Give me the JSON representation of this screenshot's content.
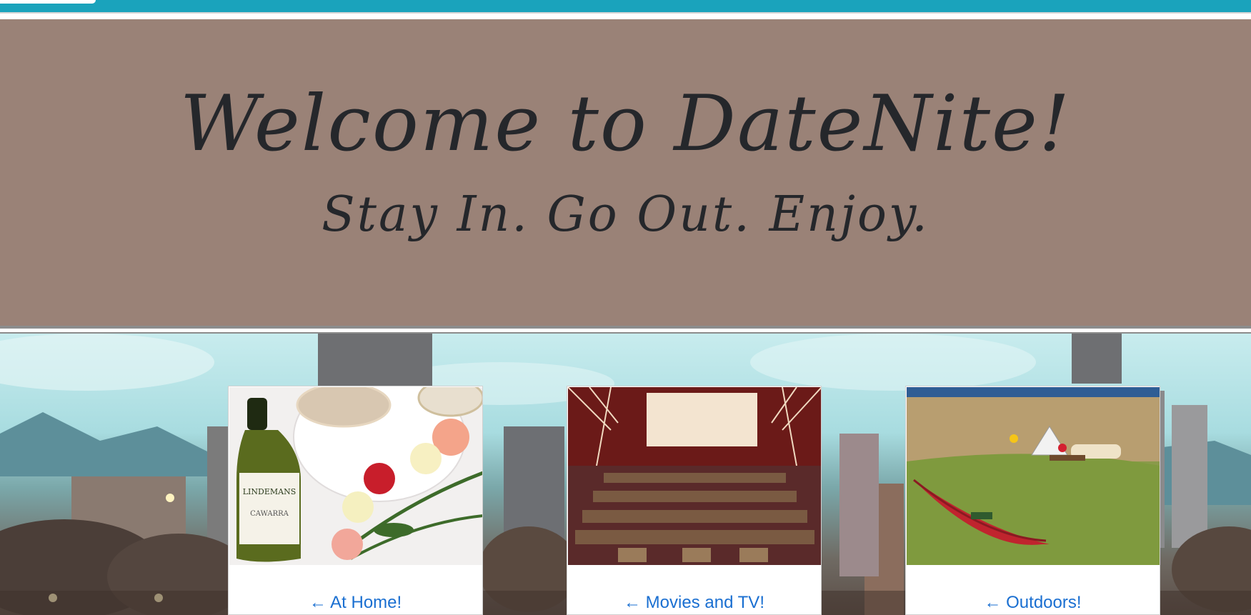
{
  "hero": {
    "title": "Welcome to DateNite!",
    "tagline": "Stay In. Go Out. Enjoy."
  },
  "cards": [
    {
      "link": "← At Home!",
      "image": "wine-and-roses-photo"
    },
    {
      "link": "← Movies and TV!",
      "image": "movie-theater-photo"
    },
    {
      "link": "← Outdoors!",
      "image": "canoe-picnic-photo"
    }
  ],
  "colors": {
    "topbar": "#1aa3bc",
    "hero_background": "#9a8277",
    "hero_text": "#25272b",
    "link": "#1a6fd1"
  }
}
